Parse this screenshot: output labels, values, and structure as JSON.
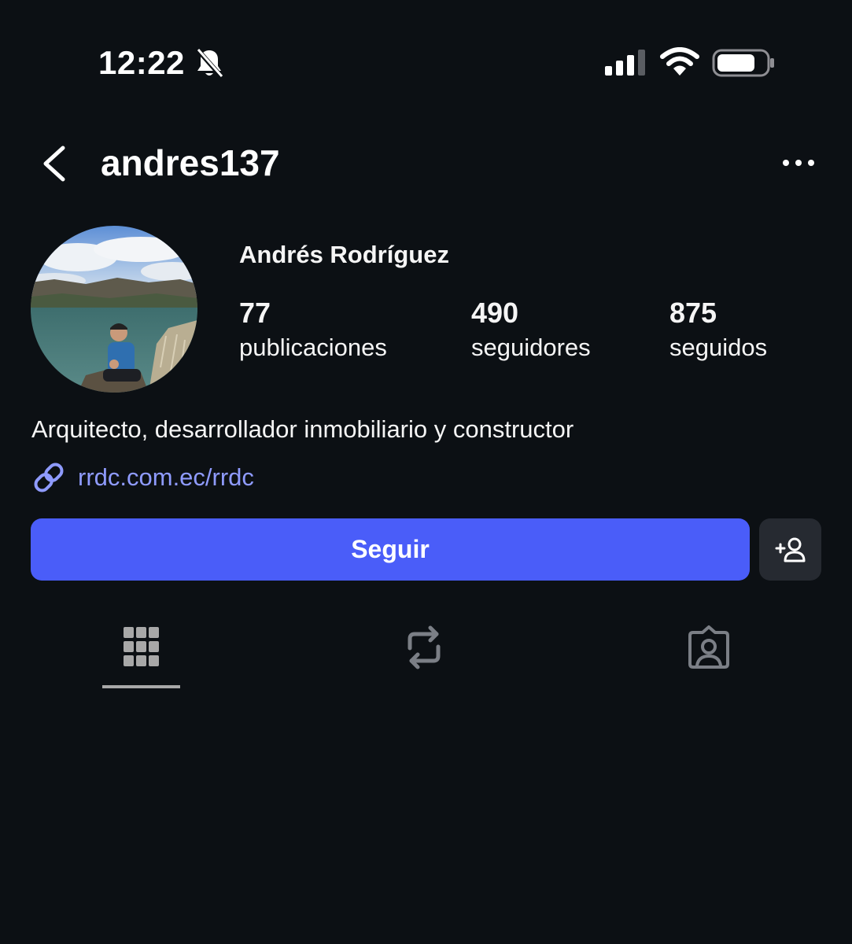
{
  "status_bar": {
    "time": "12:22",
    "icons": [
      "bell-off-icon",
      "signal-icon",
      "wifi-icon",
      "battery-icon"
    ]
  },
  "header": {
    "username": "andres137",
    "back_icon": "chevron-left-icon",
    "more_icon": "more-horizontal-icon"
  },
  "profile": {
    "display_name": "Andrés Rodríguez",
    "stats": [
      {
        "value": "77",
        "label": "publicaciones"
      },
      {
        "value": "490",
        "label": "seguidores"
      },
      {
        "value": "875",
        "label": "seguidos"
      }
    ],
    "bio": "Arquitecto, desarrollador inmobiliario y constructor",
    "link": "rrdc.com.ec/rrdc"
  },
  "actions": {
    "follow_label": "Seguir",
    "suggest_icon": "add-person-icon"
  },
  "tabs": [
    {
      "icon": "grid-icon",
      "active": true
    },
    {
      "icon": "repost-icon",
      "active": false
    },
    {
      "icon": "tagged-person-icon",
      "active": false
    }
  ],
  "colors": {
    "background": "#0c1014",
    "accent": "#4a5df9",
    "link": "#8f9bff",
    "secondary_button": "#262a31",
    "icon_inactive": "#7b7f86"
  }
}
